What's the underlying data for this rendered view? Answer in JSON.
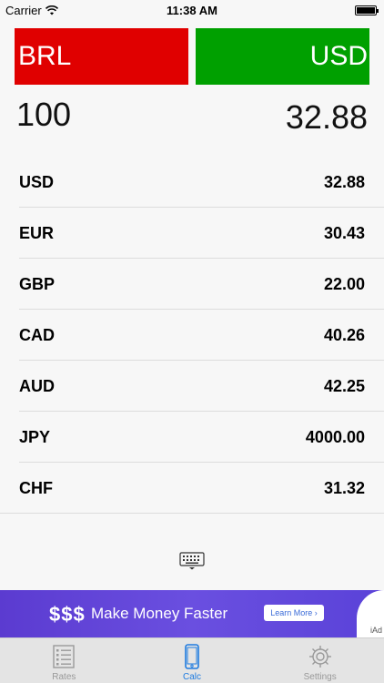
{
  "status_bar": {
    "carrier": "Carrier",
    "time": "11:38 AM"
  },
  "converter": {
    "from_currency": "BRL",
    "to_currency": "USD",
    "amount": "100",
    "result": "32.88",
    "colors": {
      "from": "#e00000",
      "to": "#00a000"
    }
  },
  "rates": [
    {
      "code": "USD",
      "value": "32.88"
    },
    {
      "code": "EUR",
      "value": "30.43"
    },
    {
      "code": "GBP",
      "value": "22.00"
    },
    {
      "code": "CAD",
      "value": "40.26"
    },
    {
      "code": "AUD",
      "value": "42.25"
    },
    {
      "code": "JPY",
      "value": "4000.00"
    },
    {
      "code": "CHF",
      "value": "31.32"
    }
  ],
  "ad": {
    "dollars": "$$$",
    "headline": "Make Money Faster",
    "cta": "Learn More ›",
    "badge": "iAd"
  },
  "tabs": [
    {
      "label": "Rates",
      "icon": "list-icon"
    },
    {
      "label": "Calc",
      "icon": "phone-icon"
    },
    {
      "label": "Settings",
      "icon": "gear-icon"
    }
  ],
  "active_tab": "Calc"
}
